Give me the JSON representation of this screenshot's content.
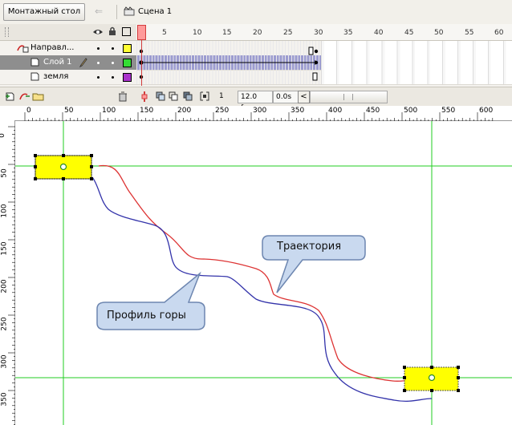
{
  "toolbar": {
    "stage_button": "Монтажный стол",
    "scene_label": "Сцена 1"
  },
  "timeline": {
    "frame_numbers": [
      "1",
      "5",
      "10",
      "15",
      "20",
      "25",
      "30",
      "35",
      "40",
      "45",
      "50",
      "55",
      "60"
    ],
    "layers": [
      {
        "name": "Направл...",
        "color": "#ffff33"
      },
      {
        "name": "Слой 1",
        "color": "#33dd33",
        "selected": true
      },
      {
        "name": "земля",
        "color": "#aa33cc"
      }
    ],
    "current_frame": "1",
    "fps": "12.0 fps",
    "time": "0.0s"
  },
  "ruler": {
    "horizontal": [
      "0",
      "50",
      "100",
      "150",
      "200",
      "250",
      "300",
      "350",
      "400",
      "450",
      "500",
      "550",
      "600"
    ],
    "vertical": [
      "0",
      "50",
      "100",
      "150",
      "200",
      "250",
      "300",
      "350"
    ]
  },
  "stage": {
    "callout_trajectory": "Траектория",
    "callout_mountain": "Профиль горы"
  },
  "icons": [
    "grip-icon",
    "eye-icon",
    "lock-icon",
    "outline-icon",
    "guide-layer-icon",
    "layer-icon",
    "pencil-icon",
    "add-layer-icon",
    "add-guide-icon",
    "add-folder-icon",
    "trash-icon",
    "onion-center-icon",
    "onion-skin-icon",
    "onion-outline-icon",
    "edit-multiple-icon",
    "onion-markers-icon",
    "scene-icon",
    "back-arrow-icon"
  ],
  "colors": {
    "accent_playhead": "#d23c3c",
    "guide_line": "#22cc22",
    "trajectory": "#dd3333",
    "mountain": "#3333aa",
    "object_fill": "#ffff00"
  }
}
